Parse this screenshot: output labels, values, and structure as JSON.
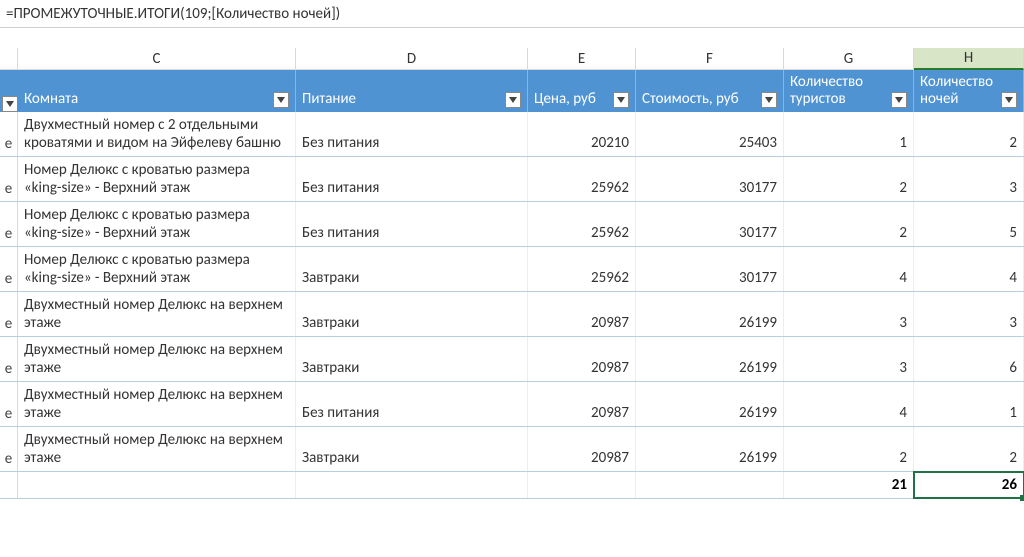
{
  "formula": "=ПРОМЕЖУТОЧНЫЕ.ИТОГИ(109;[Количество ночей])",
  "stub_letter": "e",
  "columns": {
    "C": "C",
    "D": "D",
    "E": "E",
    "F": "F",
    "G": "G",
    "H": "H"
  },
  "headers": {
    "room": "Комната",
    "meal": "Питание",
    "price": "Цена, руб",
    "cost": "Стоимость, руб",
    "tourists": "Количество туристов",
    "nights": "Количество ночей"
  },
  "rows": [
    {
      "room": "Двухместный номер с 2 отдельными кроватями и видом на Эйфелеву башню",
      "meal": "Без питания",
      "price": "20210",
      "cost": "25403",
      "tourists": "1",
      "nights": "2"
    },
    {
      "room": "Номер Делюкс с кроватью размера «king-size» - Верхний этаж",
      "meal": "Без питания",
      "price": "25962",
      "cost": "30177",
      "tourists": "2",
      "nights": "3"
    },
    {
      "room": "Номер Делюкс с кроватью размера «king-size» - Верхний этаж",
      "meal": "Без питания",
      "price": "25962",
      "cost": "30177",
      "tourists": "2",
      "nights": "5"
    },
    {
      "room": "Номер Делюкс с кроватью размера «king-size» - Верхний этаж",
      "meal": "Завтраки",
      "price": "25962",
      "cost": "30177",
      "tourists": "4",
      "nights": "4"
    },
    {
      "room": "Двухместный номер Делюкс на верхнем этаже",
      "meal": "Завтраки",
      "price": "20987",
      "cost": "26199",
      "tourists": "3",
      "nights": "3"
    },
    {
      "room": "Двухместный номер Делюкс на верхнем этаже",
      "meal": "Завтраки",
      "price": "20987",
      "cost": "26199",
      "tourists": "3",
      "nights": "6"
    },
    {
      "room": "Двухместный номер Делюкс на верхнем этаже",
      "meal": "Без питания",
      "price": "20987",
      "cost": "26199",
      "tourists": "4",
      "nights": "1"
    },
    {
      "room": "Двухместный номер Делюкс на верхнем этаже",
      "meal": "Завтраки",
      "price": "20987",
      "cost": "26199",
      "tourists": "2",
      "nights": "2"
    }
  ],
  "totals": {
    "tourists": "21",
    "nights": "26"
  },
  "chart_data": {
    "type": "table",
    "columns": [
      "Комната",
      "Питание",
      "Цена, руб",
      "Стоимость, руб",
      "Количество туристов",
      "Количество ночей"
    ],
    "rows": [
      [
        "Двухместный номер с 2 отдельными кроватями и видом на Эйфелеву башню",
        "Без питания",
        20210,
        25403,
        1,
        2
      ],
      [
        "Номер Делюкс с кроватью размера «king-size» - Верхний этаж",
        "Без питания",
        25962,
        30177,
        2,
        3
      ],
      [
        "Номер Делюкс с кроватью размера «king-size» - Верхний этаж",
        "Без питания",
        25962,
        30177,
        2,
        5
      ],
      [
        "Номер Делюкс с кроватью размера «king-size» - Верхний этаж",
        "Завтраки",
        25962,
        30177,
        4,
        4
      ],
      [
        "Двухместный номер Делюкс на верхнем этаже",
        "Завтраки",
        20987,
        26199,
        3,
        3
      ],
      [
        "Двухместный номер Делюкс на верхнем этаже",
        "Завтраки",
        20987,
        26199,
        3,
        6
      ],
      [
        "Двухместный номер Делюкс на верхнем этаже",
        "Без питания",
        20987,
        26199,
        4,
        1
      ],
      [
        "Двухместный номер Делюкс на верхнем этаже",
        "Завтраки",
        20987,
        26199,
        2,
        2
      ]
    ],
    "totals": {
      "Количество туристов": 21,
      "Количество ночей": 26
    }
  }
}
